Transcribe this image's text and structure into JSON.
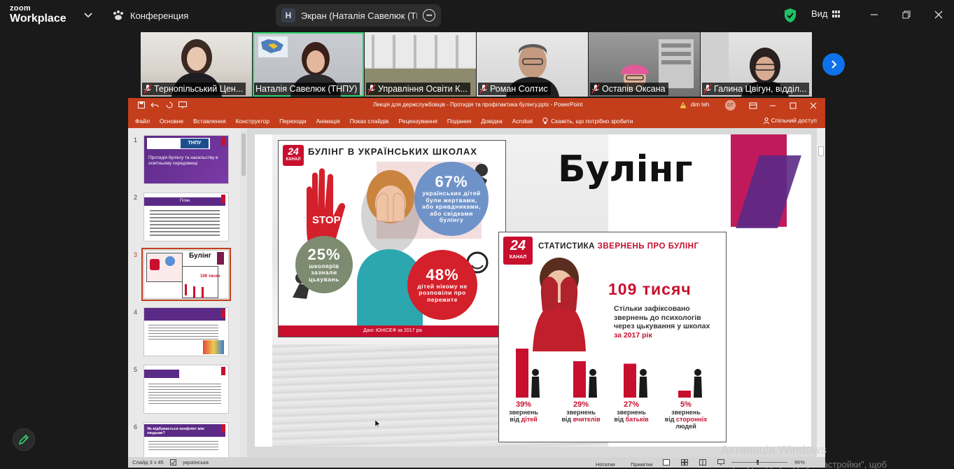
{
  "zoom": {
    "logo_line1": "zoom",
    "logo_line2": "Workplace",
    "conference_label": "Конференция",
    "screen_share_initial": "Н",
    "screen_share_label": "Экран (Наталія Савелюк (ТНПУ",
    "view_label": "Вид",
    "colors": {
      "accent": "#0e72ed",
      "active_tile": "#2ed36c",
      "shield": "#1fc262"
    }
  },
  "participants": [
    {
      "name": "Тернопільський Цен..."
    },
    {
      "name": "Наталія Савелюк (ТНПУ)"
    },
    {
      "name": "Управління Освіти К..."
    },
    {
      "name": "Роман Солтис"
    },
    {
      "name": "Остапів Оксана"
    },
    {
      "name": "Галина Цвігун, відділ..."
    }
  ],
  "ppt": {
    "title": "Лекція для держслужбовців - Протидія та профілактика булінгу.pptx  -  PowerPoint",
    "user": "dim teh",
    "user_initials": "DT",
    "menu": [
      "Файл",
      "Основне",
      "Вставлення",
      "Конструктор",
      "Переходи",
      "Анімація",
      "Показ слайдів",
      "Рецензування",
      "Подання",
      "Довідка",
      "Acrobat"
    ],
    "tell_me": "Скажіть, що потрібно зробити",
    "share": "Спільний доступ",
    "status_slide": "Слайд 3 з 45",
    "status_lang": "українська",
    "status_notes": "Нотатки",
    "status_comments": "Примітки",
    "status_zoom": "96%",
    "colors": {
      "brand": "#c43e1c"
    }
  },
  "thumbnails": [
    {
      "num": "1",
      "text": "Протидія булінгу та насильству в освітньому середовищі"
    },
    {
      "num": "2",
      "text": "План"
    },
    {
      "num": "3",
      "text": "Булінг"
    },
    {
      "num": "4",
      "text": ""
    },
    {
      "num": "5",
      "text": ""
    },
    {
      "num": "6",
      "text": "Як відбувається конфлікт між людьми?"
    }
  ],
  "slide": {
    "title": "Булінг",
    "logo_num": "24",
    "logo_word": "КАНАЛ",
    "infoA": {
      "header": "БУЛІНГ В УКРАЇНСЬКИХ ШКОЛАХ",
      "stop": "STOP",
      "b67_pct": "67%",
      "b67_text": "українських дітей були жертвами, або кривдниками, або свідками булінгу",
      "b25_pct": "25%",
      "b25_text": "школярів зазнали цькувань",
      "b48_pct": "48%",
      "b48_text": "дітей нікому не розповіли про пережите",
      "source": "Дані: ЮНІСЕФ за 2017 рік"
    },
    "infoB": {
      "header_prefix": "СТАТИСТИКА ",
      "header_accent": "ЗВЕРНЕНЬ ПРО БУЛІНГ",
      "big": "109 тисяч",
      "desc_main": "Стільки зафіксовано звернень до психологів через цькування у школах ",
      "desc_accent": "за 2017 рік"
    }
  },
  "chart_data": {
    "type": "bar",
    "categories": [
      "дітей",
      "вчителів",
      "батьків",
      "сторонніх людей"
    ],
    "values": [
      39,
      29,
      27,
      5
    ],
    "labels": [
      "39%",
      "29%",
      "27%",
      "5%"
    ],
    "label_prefix": [
      "звернень від",
      "звернень від",
      "звернень від",
      "звернень від"
    ],
    "label_line3": [
      "",
      "",
      "",
      "людей"
    ],
    "label_accent": [
      "дітей",
      "вчителів",
      "батьків",
      "сторонніх"
    ],
    "bar_color": "#c8102e"
  },
  "windows": {
    "activation_title": "Активація Windows",
    "activation_sub": "Перейдіть до розділу \"Настройки\", щоб"
  }
}
